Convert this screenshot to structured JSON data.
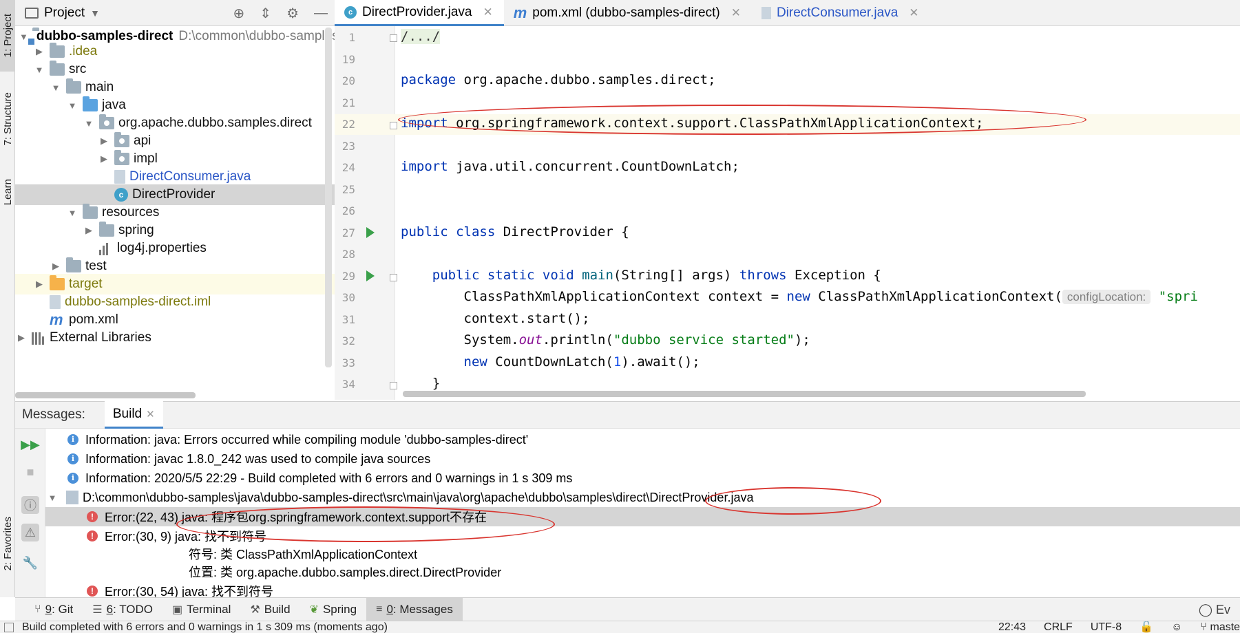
{
  "left_strip": {
    "tabs": [
      "1: Project",
      "7: Structure",
      "Learn",
      "2: Favorites"
    ]
  },
  "project_panel": {
    "title": "Project",
    "tree": [
      {
        "label": "dubbo-samples-direct",
        "path": "D:\\common\\dubbo-samples\\java\\dubbo-samples-direct",
        "icon": "module-folder-icon"
      },
      {
        "label": ".idea",
        "icon": "folder-icon"
      },
      {
        "label": "src",
        "icon": "folder-icon"
      },
      {
        "label": "main",
        "icon": "folder-icon"
      },
      {
        "label": "java",
        "icon": "source-folder-icon"
      },
      {
        "label": "org.apache.dubbo.samples.direct",
        "icon": "package-icon"
      },
      {
        "label": "api",
        "icon": "package-icon"
      },
      {
        "label": "impl",
        "icon": "package-icon"
      },
      {
        "label": "DirectConsumer.java",
        "icon": "java-file-icon"
      },
      {
        "label": "DirectProvider",
        "icon": "java-class-icon"
      },
      {
        "label": "resources",
        "icon": "resources-folder-icon"
      },
      {
        "label": "spring",
        "icon": "folder-icon"
      },
      {
        "label": "log4j.properties",
        "icon": "properties-file-icon"
      },
      {
        "label": "test",
        "icon": "folder-icon"
      },
      {
        "label": "target",
        "icon": "excluded-folder-icon"
      },
      {
        "label": "dubbo-samples-direct.iml",
        "icon": "iml-file-icon"
      },
      {
        "label": "pom.xml",
        "icon": "maven-icon"
      },
      {
        "label": "External Libraries",
        "icon": "libraries-icon"
      }
    ]
  },
  "editor_tabs": [
    {
      "label": "DirectProvider.java",
      "icon": "java-class-icon"
    },
    {
      "label": "pom.xml (dubbo-samples-direct)",
      "icon": "maven-icon"
    },
    {
      "label": "DirectConsumer.java",
      "icon": "java-file-icon"
    }
  ],
  "editor": {
    "line_numbers": [
      "1",
      "19",
      "20",
      "21",
      "22",
      "23",
      "24",
      "25",
      "26",
      "27",
      "28",
      "29",
      "30",
      "31",
      "32",
      "33",
      "34"
    ],
    "lines": {
      "l1": "/.../",
      "l20_kw": "package",
      "l20_rest": " org.apache.dubbo.samples.direct;",
      "l22_kw": "import",
      "l22_rest": " org.springframework.context.support.ClassPathXmlApplicationContext;",
      "l24_kw": "import",
      "l24_rest": " java.util.concurrent.CountDownLatch;",
      "l27_kw": "public class",
      "l27_rest": " DirectProvider {",
      "l29_kw1": "public static void",
      "l29_fn": "main",
      "l29_mid": "(String[] args) ",
      "l29_kw2": "throws",
      "l29_rest": " Exception {",
      "l30_a": "ClassPathXmlApplicationContext context = ",
      "l30_kw": "new",
      "l30_b": " ClassPathXmlApplicationContext(",
      "l30_hint": "configLocation:",
      "l30_str": "\"spri",
      "l31": "context.start();",
      "l32_a": "System.",
      "l32_static": "out",
      "l32_b": ".println(",
      "l32_str": "\"dubbo service started\"",
      "l32_c": ");",
      "l33_kw": "new",
      "l33_a": " CountDownLatch(",
      "l33_num": "1",
      "l33_b": ").await();",
      "l34": "}"
    }
  },
  "messages": {
    "label": "Messages:",
    "tab": "Build",
    "rows": [
      {
        "type": "info",
        "text": "Information: java: Errors occurred while compiling module 'dubbo-samples-direct'"
      },
      {
        "type": "info",
        "text": "Information: javac 1.8.0_242 was used to compile java sources"
      },
      {
        "type": "info",
        "text": "Information: 2020/5/5 22:29 - Build completed with 6 errors and 0 warnings in 1 s 309 ms"
      },
      {
        "type": "file",
        "text": "D:\\common\\dubbo-samples\\java\\dubbo-samples-direct\\src\\main\\java\\org\\apache\\dubbo\\samples\\direct\\DirectProvider.java"
      },
      {
        "type": "error",
        "text": "Error:(22, 43)  java: 程序包org.springframework.context.support不存在"
      },
      {
        "type": "error",
        "text": "Error:(30, 9)  java: 找不到符号"
      },
      {
        "type": "detail",
        "text": "符号:   类 ClassPathXmlApplicationContext"
      },
      {
        "type": "detail",
        "text": "位置: 类 org.apache.dubbo.samples.direct.DirectProvider"
      },
      {
        "type": "error",
        "text": "Error:(30, 54)  java: 找不到符号"
      }
    ]
  },
  "bottom_tools": [
    {
      "num": "9",
      "label": ": Git",
      "icon": "git-icon"
    },
    {
      "num": "6",
      "label": ": TODO",
      "icon": "todo-icon"
    },
    {
      "num": "",
      "label": "Terminal",
      "icon": "terminal-icon"
    },
    {
      "num": "",
      "label": "Build",
      "icon": "build-icon"
    },
    {
      "num": "",
      "label": "Spring",
      "icon": "spring-icon"
    },
    {
      "num": "0",
      "label": ": Messages",
      "icon": "messages-icon"
    }
  ],
  "event_log": "Ev",
  "status": {
    "message": "Build completed with 6 errors and 0 warnings in 1 s 309 ms (moments ago)",
    "position": "22:43",
    "line_sep": "CRLF",
    "encoding": "UTF-8",
    "branch": "master"
  }
}
